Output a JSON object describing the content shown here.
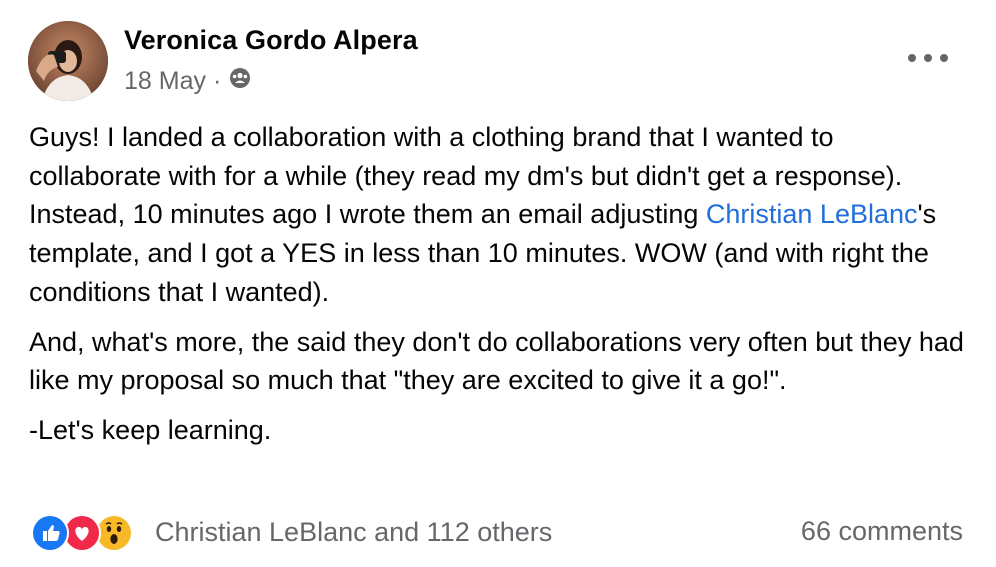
{
  "post": {
    "author": "Veronica Gordo Alpera",
    "date": "18 May",
    "separator": "·",
    "privacy_icon": "group-audience-icon",
    "more_icon": "more-options-icon",
    "paragraphs": {
      "p1_before": "Guys! I landed a collaboration with a clothing brand that I wanted to collaborate with for a while (they read my dm's but didn't get a response). Instead, 10 minutes ago I wrote them an email adjusting ",
      "p1_mention": "Christian LeBlanc",
      "p1_after": "'s template, and I got a YES in less than 10 minutes. WOW (and with right the conditions that I wanted).",
      "p2": "And, what's more, the said they don't do collaborations very often but they had like my proposal so much that \"they are excited to give it a go!\".",
      "p3": "-Let's keep learning."
    },
    "reactions": {
      "icons": [
        "like-icon",
        "love-icon",
        "wow-icon"
      ],
      "label": "Christian LeBlanc and 112 others"
    },
    "comments_label": "66 comments",
    "colors": {
      "like": "#1877f2",
      "love": "#f0284a",
      "wow": "#f7b928",
      "mention": "#216fdb",
      "secondary_text": "#65676b"
    }
  }
}
